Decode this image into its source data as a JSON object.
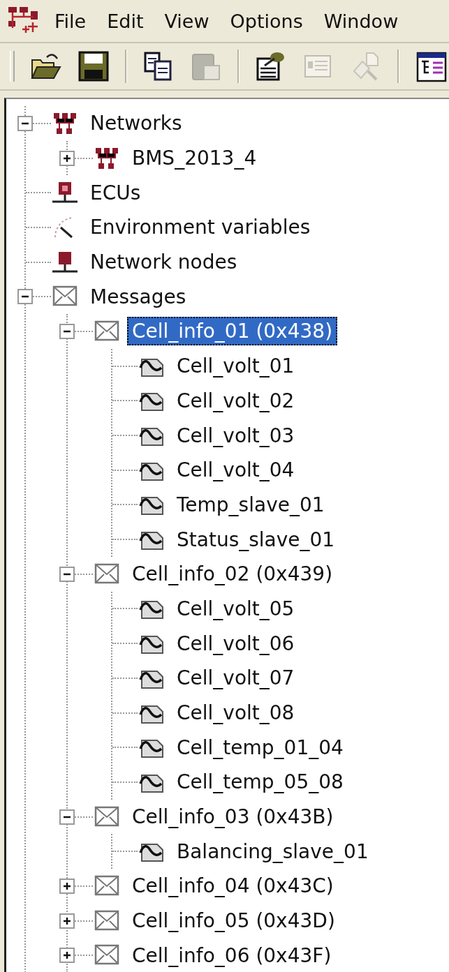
{
  "menu": {
    "items": [
      {
        "label": "File"
      },
      {
        "label": "Edit"
      },
      {
        "label": "View"
      },
      {
        "label": "Options"
      },
      {
        "label": "Window"
      }
    ]
  },
  "toolbar": {
    "groups": [
      {
        "buttons": [
          {
            "kind": "open",
            "disabled": false
          },
          {
            "kind": "save",
            "disabled": false
          }
        ]
      },
      {
        "buttons": [
          {
            "kind": "copy",
            "disabled": false
          },
          {
            "kind": "paste",
            "disabled": true
          }
        ]
      },
      {
        "buttons": [
          {
            "kind": "properties",
            "disabled": false
          },
          {
            "kind": "form",
            "disabled": true
          },
          {
            "kind": "wizard",
            "disabled": true
          }
        ]
      },
      {
        "buttons": [
          {
            "kind": "tree",
            "disabled": false
          }
        ]
      }
    ]
  },
  "tree": {
    "items": [
      {
        "label": "Networks",
        "kind": "network",
        "expanded": true,
        "selected": false,
        "children": [
          {
            "label": "BMS_2013_4",
            "kind": "network",
            "expanded": false,
            "selected": false
          }
        ]
      },
      {
        "label": "ECUs",
        "kind": "ecu",
        "selected": false
      },
      {
        "label": "Environment variables",
        "kind": "envvar",
        "selected": false
      },
      {
        "label": "Network nodes",
        "kind": "node",
        "selected": false
      },
      {
        "label": "Messages",
        "kind": "message",
        "expanded": true,
        "selected": false,
        "children": [
          {
            "label": "Cell_info_01 (0x438)",
            "kind": "message",
            "expanded": true,
            "selected": true,
            "children": [
              {
                "label": "Cell_volt_01",
                "kind": "signal",
                "selected": false
              },
              {
                "label": "Cell_volt_02",
                "kind": "signal",
                "selected": false
              },
              {
                "label": "Cell_volt_03",
                "kind": "signal",
                "selected": false
              },
              {
                "label": "Cell_volt_04",
                "kind": "signal",
                "selected": false
              },
              {
                "label": "Temp_slave_01",
                "kind": "signal",
                "selected": false
              },
              {
                "label": "Status_slave_01",
                "kind": "signal",
                "selected": false
              }
            ]
          },
          {
            "label": "Cell_info_02 (0x439)",
            "kind": "message",
            "expanded": true,
            "selected": false,
            "children": [
              {
                "label": "Cell_volt_05",
                "kind": "signal",
                "selected": false
              },
              {
                "label": "Cell_volt_06",
                "kind": "signal",
                "selected": false
              },
              {
                "label": "Cell_volt_07",
                "kind": "signal",
                "selected": false
              },
              {
                "label": "Cell_volt_08",
                "kind": "signal",
                "selected": false
              },
              {
                "label": "Cell_temp_01_04",
                "kind": "signal",
                "selected": false
              },
              {
                "label": "Cell_temp_05_08",
                "kind": "signal",
                "selected": false
              }
            ]
          },
          {
            "label": "Cell_info_03 (0x43B)",
            "kind": "message",
            "expanded": true,
            "selected": false,
            "children": [
              {
                "label": "Balancing_slave_01",
                "kind": "signal",
                "selected": false
              }
            ]
          },
          {
            "label": "Cell_info_04 (0x43C)",
            "kind": "message",
            "expanded": false,
            "selected": false
          },
          {
            "label": "Cell_info_05 (0x43D)",
            "kind": "message",
            "expanded": false,
            "selected": false
          },
          {
            "label": "Cell_info_06 (0x43F)",
            "kind": "message",
            "expanded": false,
            "selected": false
          }
        ]
      }
    ]
  }
}
